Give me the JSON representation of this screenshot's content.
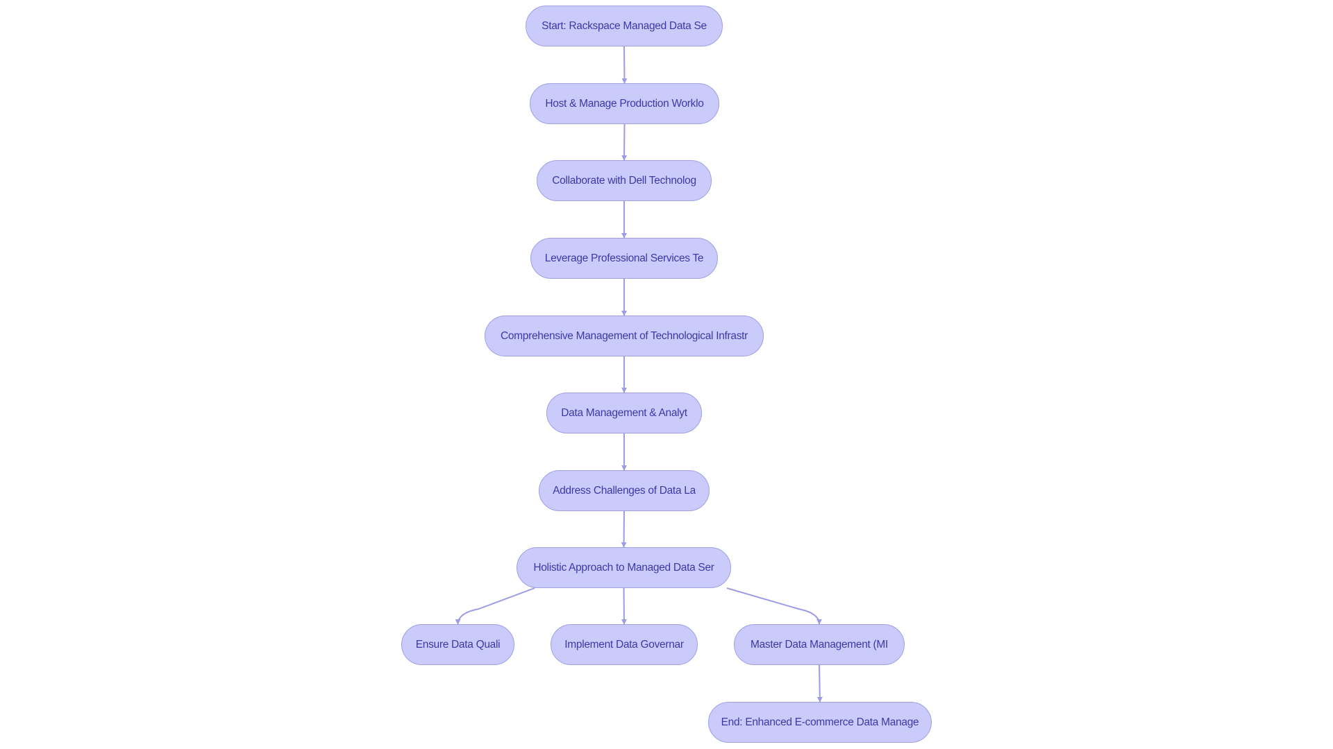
{
  "diagram": {
    "type": "flowchart",
    "direction": "top-down",
    "colors": {
      "node_fill": "#cbcbfb",
      "node_stroke": "#9e9ee6",
      "node_text": "#3a3aa6",
      "edge": "#9c9ce6",
      "background": "#ffffff"
    },
    "nodes": [
      {
        "id": "start",
        "label": "Start: Rackspace Managed Data Se"
      },
      {
        "id": "host",
        "label": "Host & Manage Production Worklo"
      },
      {
        "id": "collab",
        "label": "Collaborate with Dell Technolog"
      },
      {
        "id": "leverage",
        "label": "Leverage Professional Services Te"
      },
      {
        "id": "comprehensive",
        "label": "Comprehensive Management of Technological Infrastr"
      },
      {
        "id": "datamgmt",
        "label": "Data Management & Analyt"
      },
      {
        "id": "address",
        "label": "Address Challenges of Data La"
      },
      {
        "id": "holistic",
        "label": "Holistic Approach to Managed Data Ser"
      },
      {
        "id": "quality",
        "label": "Ensure Data Quali"
      },
      {
        "id": "governance",
        "label": "Implement Data Governar"
      },
      {
        "id": "mdm",
        "label": "Master Data Management (MI"
      },
      {
        "id": "end",
        "label": "End: Enhanced E-commerce Data Manage"
      }
    ],
    "edges": [
      {
        "from": "start",
        "to": "host"
      },
      {
        "from": "host",
        "to": "collab"
      },
      {
        "from": "collab",
        "to": "leverage"
      },
      {
        "from": "leverage",
        "to": "comprehensive"
      },
      {
        "from": "comprehensive",
        "to": "datamgmt"
      },
      {
        "from": "datamgmt",
        "to": "address"
      },
      {
        "from": "address",
        "to": "holistic"
      },
      {
        "from": "holistic",
        "to": "quality"
      },
      {
        "from": "holistic",
        "to": "governance"
      },
      {
        "from": "holistic",
        "to": "mdm"
      },
      {
        "from": "mdm",
        "to": "end"
      }
    ]
  }
}
